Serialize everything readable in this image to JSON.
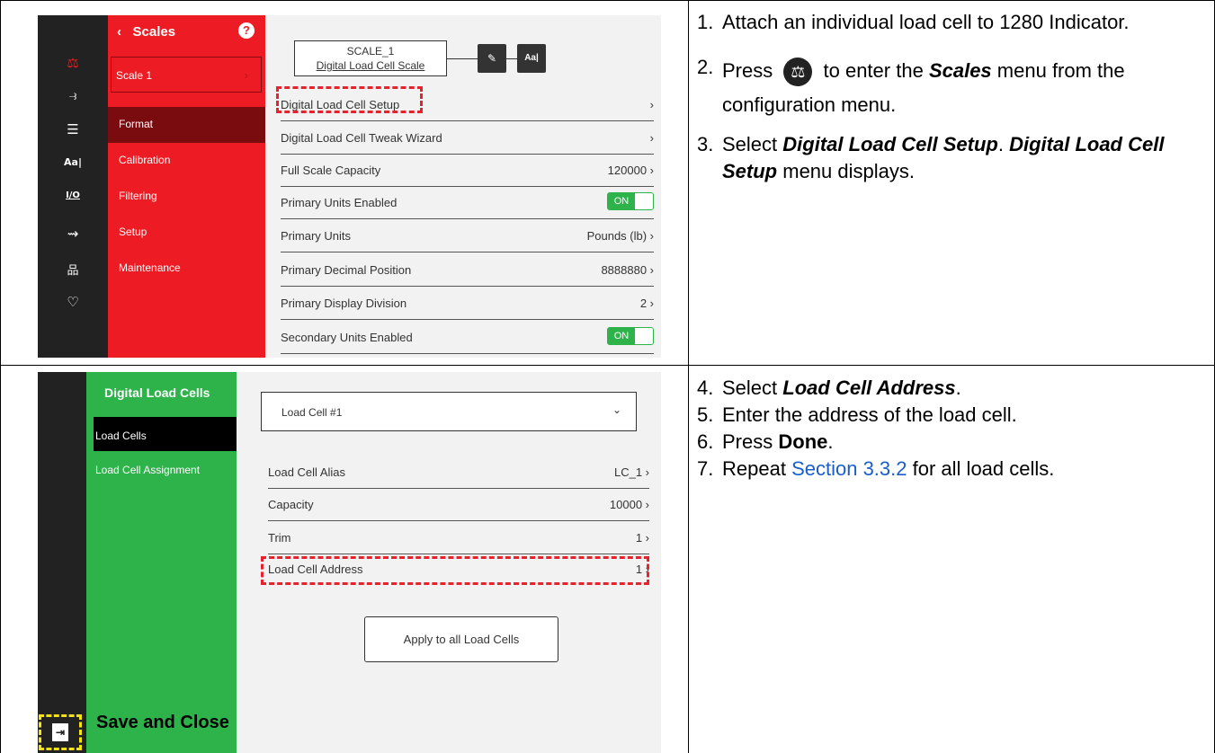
{
  "panel1": {
    "nav_icons": [
      "scale-icon",
      "wireless-icon",
      "list-icon",
      "font-icon",
      "io-icon",
      "route-icon",
      "network-icon",
      "health-icon"
    ],
    "nav_glyphs": [
      "⚖",
      "⥽",
      "☰",
      "Aa|",
      "I/O",
      "⇝",
      "品",
      "♡"
    ],
    "header": "Scales",
    "back_glyph": "‹",
    "help_glyph": "?",
    "scale_select": "Scale 1",
    "scale_select_arrow": "›",
    "menu": [
      "Format",
      "Calibration",
      "Filtering",
      "Setup",
      "Maintenance"
    ],
    "scale_name": "SCALE_1",
    "scale_type": "Digital Load Cell Scale",
    "edit_glyph": "✎",
    "font_glyph": "Aa|",
    "rows": [
      {
        "label": "Digital Load Cell Setup",
        "value": "›"
      },
      {
        "label": "Digital Load Cell Tweak Wizard",
        "value": "›"
      },
      {
        "label": "Full Scale Capacity",
        "value": "120000 ›"
      },
      {
        "label": "Primary Units Enabled",
        "value": "ON"
      },
      {
        "label": "Primary Units",
        "value": "Pounds (lb) ›"
      },
      {
        "label": "Primary Decimal Position",
        "value": "8888880 ›"
      },
      {
        "label": "Primary Display Division",
        "value": "2 ›"
      },
      {
        "label": "Secondary Units Enabled",
        "value": "ON"
      }
    ]
  },
  "steps1": [
    {
      "num": "1.",
      "text": "Attach an individual load cell to 1280 Indicator."
    },
    {
      "num": "2.",
      "pre": "Press",
      "post": "to enter the",
      "em": "Scales",
      "post2": "menu from the configuration menu."
    },
    {
      "num": "3.",
      "pre": "Select",
      "em1": "Digital Load Cell Setup",
      "mid": ".",
      "em2": "Digital Load Cell Setup",
      "post": "menu displays."
    }
  ],
  "panel2": {
    "header": "Digital Load Cells",
    "menu": [
      "Load Cells",
      "Load Cell Assignment"
    ],
    "select_value": "Load Cell #1",
    "select_chevron": "⌄",
    "rows": [
      {
        "label": "Load Cell Alias",
        "value": "LC_1 ›"
      },
      {
        "label": "Capacity",
        "value": "10000 ›"
      },
      {
        "label": "Trim",
        "value": "1 ›"
      },
      {
        "label": "Load Cell Address",
        "value": "1 ›"
      }
    ],
    "apply_button": "Apply to all Load Cells",
    "save_close": "Save and Close",
    "save_glyph": "⇥"
  },
  "steps2": [
    {
      "num": "4.",
      "pre": "Select",
      "em": "Load Cell Address",
      "post": "."
    },
    {
      "num": "5.",
      "text": "Enter the address of the load cell."
    },
    {
      "num": "6.",
      "pre": "Press",
      "bold": "Done",
      "post": "."
    },
    {
      "num": "7.",
      "pre": "Repeat",
      "link": "Section 3.3.2",
      "post": "for all load cells."
    }
  ],
  "colors": {
    "red": "#ed1c24",
    "green": "#2db34a",
    "dark": "#222222",
    "link": "#1a5dcc"
  }
}
